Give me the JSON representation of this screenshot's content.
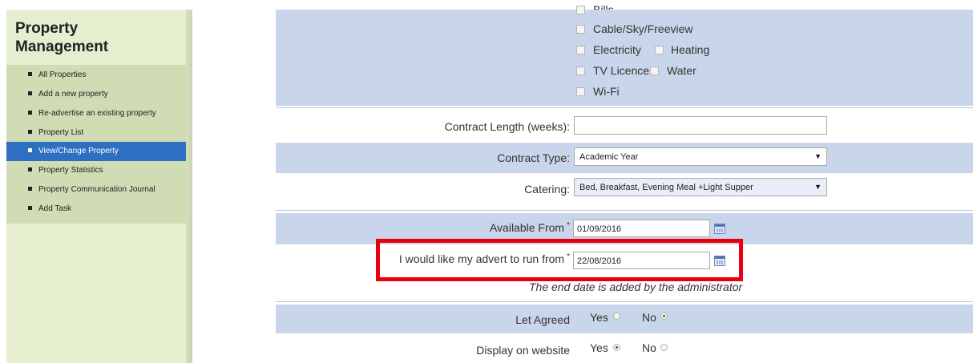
{
  "sidebar": {
    "title_line1": "Property",
    "title_line2": "Management",
    "items": [
      {
        "label": "All Properties",
        "active": false
      },
      {
        "label": "Add a new property",
        "active": false
      },
      {
        "label": "Re-advertise an existing property",
        "active": false
      },
      {
        "label": "Property List",
        "active": false
      },
      {
        "label": "View/Change Property",
        "active": true
      },
      {
        "label": "Property Statistics",
        "active": false
      },
      {
        "label": "Property Communication Journal",
        "active": false
      },
      {
        "label": "Add Task",
        "active": false
      }
    ]
  },
  "bills": {
    "partial_label": "Bills",
    "cable": "Cable/Sky/Freeview",
    "electricity": "Electricity",
    "heating": "Heating",
    "tv_licence": "TV Licence",
    "water": "Water",
    "wifi": "Wi-Fi"
  },
  "form": {
    "contract_length_label": "Contract Length (weeks):",
    "contract_length_value": "",
    "contract_type_label": "Contract Type:",
    "contract_type_value": "Academic Year",
    "catering_label": "Catering:",
    "catering_value": "Bed, Breakfast, Evening Meal +Light Supper",
    "available_from_label": "Available From",
    "available_from_value": "01/09/2016",
    "advert_run_label": "I would like my advert to run from",
    "advert_run_value": "22/08/2016",
    "required_mark": "*",
    "end_date_note": "The end date is added by the administrator",
    "let_agreed_label": "Let Agreed",
    "display_website_label": "Display on website",
    "yes": "Yes",
    "no": "No",
    "let_agreed_selected": "No",
    "display_website_selected": "Yes"
  },
  "colors": {
    "highlight": "#e8000e",
    "active_nav": "#2f6fc2",
    "form_blue": "#c9d5ea",
    "sidebar_bg": "#e6f0d0"
  }
}
